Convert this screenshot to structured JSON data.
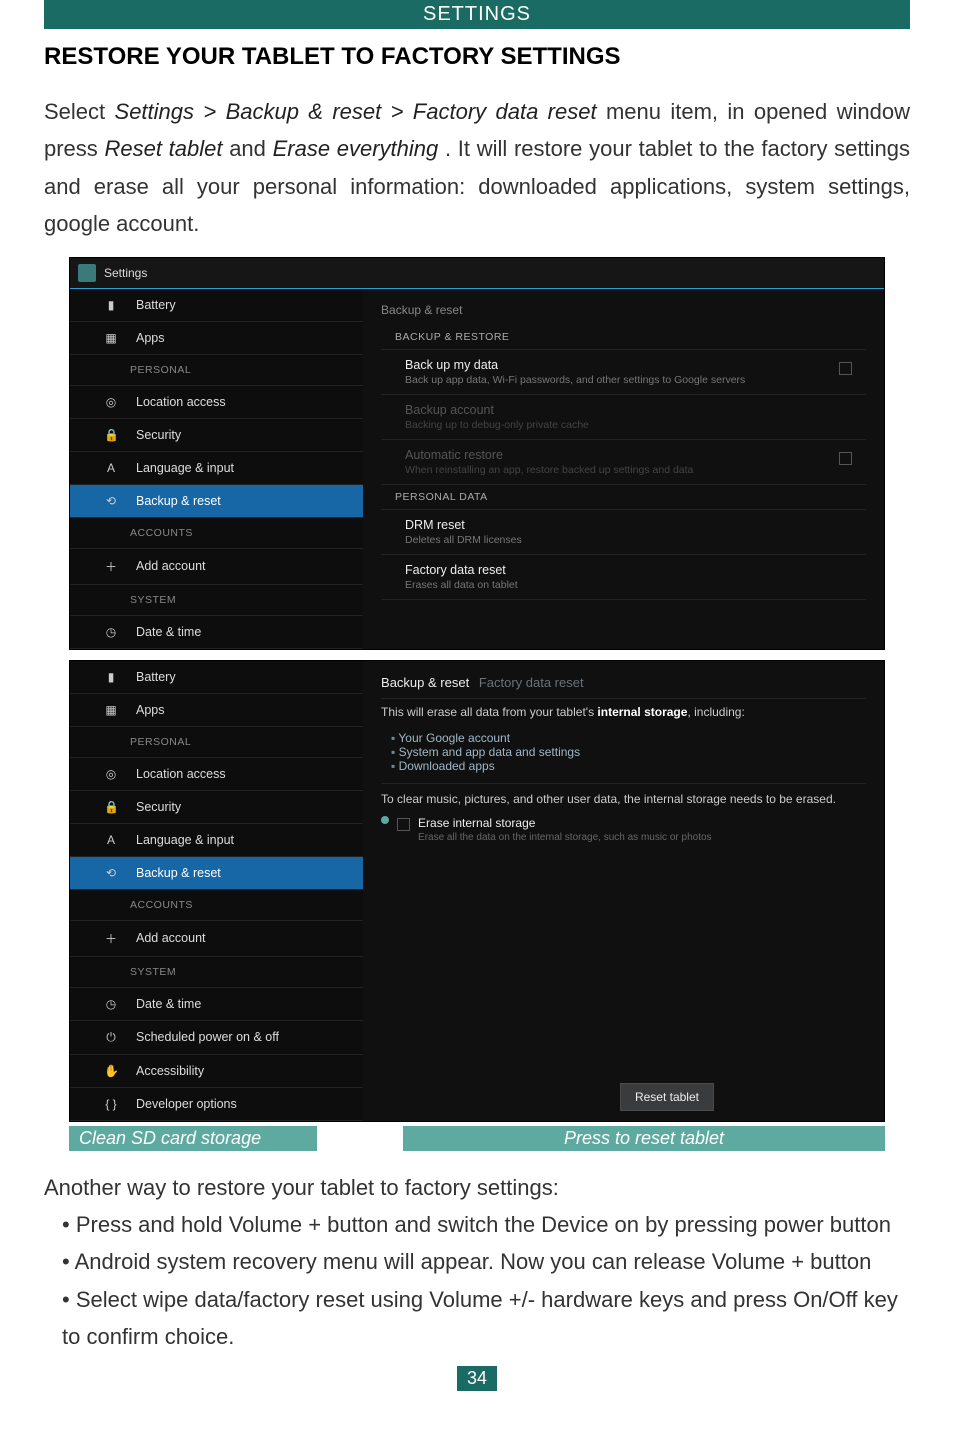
{
  "banner": "SETTINGS",
  "heading": "RESTORE YOUR TABLET TO FACTORY SETTINGS",
  "intro": {
    "before_path": "Select ",
    "path": "Settings > Backup & reset > Factory data reset",
    "mid1": " menu item, in opened window press ",
    "reset_tablet": "Reset tablet",
    "and": " and ",
    "erase_everything": "Erase everything",
    "after": ". It will restore your tablet to the factory settings and erase all your personal information: downloaded applications, system settings, google account."
  },
  "shot1": {
    "title": "Settings",
    "sidebar": {
      "battery": "Battery",
      "apps": "Apps",
      "personalHead": "PERSONAL",
      "location": "Location access",
      "security": "Security",
      "language": "Language & input",
      "backup": "Backup & reset",
      "accountsHead": "ACCOUNTS",
      "addacct": "Add account",
      "systemHead": "SYSTEM",
      "datetime": "Date & time"
    },
    "main": {
      "sectionTitle": "Backup & reset",
      "backupRestoreHead": "BACKUP & RESTORE",
      "backupData": {
        "t": "Back up my data",
        "s": "Back up app data, Wi-Fi passwords, and other settings to Google servers"
      },
      "backupAcct": {
        "t": "Backup account",
        "s": "Backing up to debug-only private cache"
      },
      "autoRestore": {
        "t": "Automatic restore",
        "s": "When reinstalling an app, restore backed up settings and data"
      },
      "personalDataHead": "PERSONAL DATA",
      "drm": {
        "t": "DRM reset",
        "s": "Deletes all DRM licenses"
      },
      "factory": {
        "t": "Factory data reset",
        "s": "Erases all data on tablet"
      }
    }
  },
  "shot2": {
    "sidebar": {
      "battery": "Battery",
      "apps": "Apps",
      "personalHead": "PERSONAL",
      "location": "Location access",
      "security": "Security",
      "language": "Language & input",
      "backup": "Backup & reset",
      "accountsHead": "ACCOUNTS",
      "addacct": "Add account",
      "systemHead": "SYSTEM",
      "datetime": "Date & time",
      "scheduled": "Scheduled power on & off",
      "accessibility": "Accessibility",
      "developer": "Developer options"
    },
    "breadcrumb": {
      "a": "Backup & reset",
      "b": "Factory data reset"
    },
    "desc_pre": "This will erase all data from your tablet's ",
    "desc_bold": "internal storage",
    "desc_post": ", including:",
    "bullets": {
      "a": "Your Google account",
      "b": "System and app data and settings",
      "c": "Downloaded apps"
    },
    "clearMsg": "To clear music, pictures, and other user data, the internal storage needs to be erased.",
    "erase": {
      "t": "Erase internal storage",
      "s": "Erase all the data on the internal storage, such as music or photos"
    },
    "resetBtn": "Reset tablet"
  },
  "annotations": {
    "clean": "Clean SD card storage",
    "press": "Press to reset tablet"
  },
  "after1": "Another way to restore your tablet to factory settings:",
  "b1": {
    "pre": "Press and hold ",
    "bold": "Volume +",
    "post": " button and switch the Device on by pressing power button"
  },
  "b2": {
    "it": "Android system recovery",
    "mid": " menu will appear. Now you can release ",
    "bold": "Volume +",
    "post": " button"
  },
  "b3": {
    "pre": "Select ",
    "it": "wipe data/factory reset",
    "mid": " using ",
    "bold": "Volume +/-",
    "mid2": " hardware keys and press ",
    "bold2": "On/Off",
    "post": " key to confirm choice."
  },
  "pageNum": "34"
}
